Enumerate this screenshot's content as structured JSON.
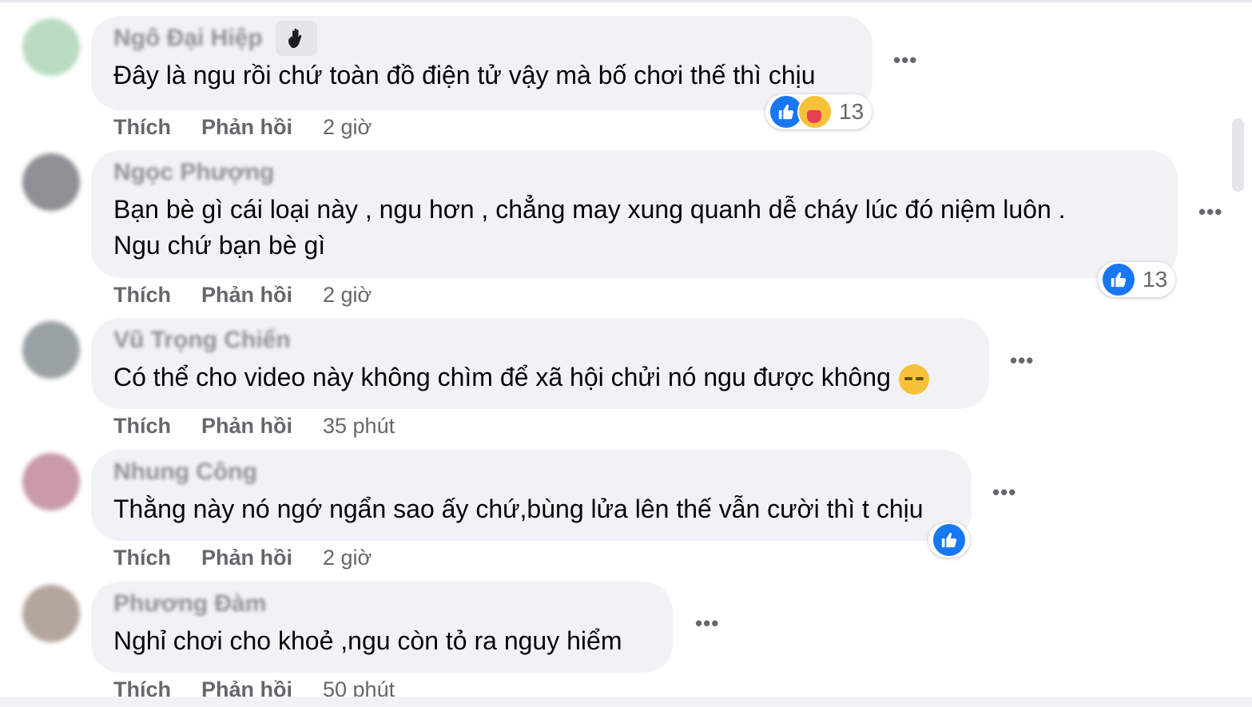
{
  "action_labels": {
    "like": "Thích",
    "reply": "Phản hồi"
  },
  "colors": {
    "like_blue": "#1877f2",
    "bubble_bg": "#f0f2f5",
    "meta_gray": "#65676b"
  },
  "comments": [
    {
      "author": "Ngô Đại Hiệp",
      "has_badge": true,
      "badge_icon": "waving-hand-icon",
      "text": "Đây là ngu rồi chứ toàn đồ điện tử vậy mà bố chơi thế thì chịu",
      "reactions": [
        "like-icon",
        "care-icon"
      ],
      "reaction_count": "13",
      "time": "2 giờ"
    },
    {
      "author": "Ngọc Phượng",
      "text_line1": "Bạn bè gì cái loại này , ngu hơn , chẳng may xung quanh dễ cháy lúc đó niệm luôn .",
      "text_line2": "Ngu chứ bạn bè gì",
      "reactions": [
        "like-icon"
      ],
      "reaction_count": "13",
      "time": "2 giờ"
    },
    {
      "author": "Vũ Trọng Chiến",
      "text": "Có thể cho video này không chìm để xã hội chửi nó ngu được không",
      "emoji": "sleepy-face-icon",
      "time": "35 phút"
    },
    {
      "author": "Nhung Công",
      "text": "Thằng này nó ngớ ngẩn sao ấy chứ,bùng lửa lên thế vẫn cười thì t chịu",
      "reactions": [
        "like-icon"
      ],
      "time": "2 giờ"
    },
    {
      "author": "Phương Đàm",
      "text": "Nghỉ chơi cho khoẻ ,ngu còn tỏ ra nguy hiểm",
      "time": "50 phút"
    }
  ]
}
